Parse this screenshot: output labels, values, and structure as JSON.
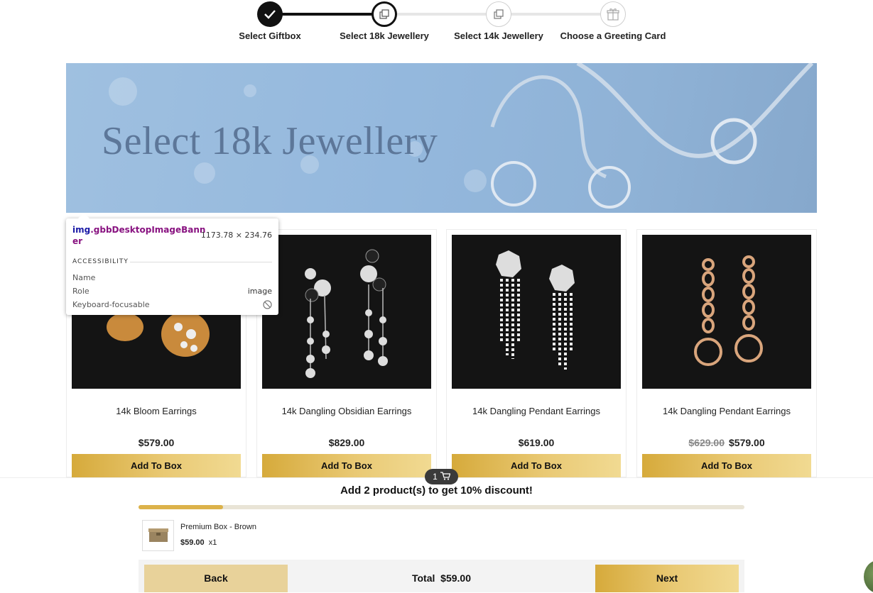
{
  "stepper": {
    "steps": [
      {
        "label": "Select Giftbox",
        "state": "complete"
      },
      {
        "label": "Select 18k Jewellery",
        "state": "current"
      },
      {
        "label": "Select 14k Jewellery",
        "state": "pending"
      },
      {
        "label": "Choose a Greeting Card",
        "state": "pending"
      }
    ]
  },
  "banner": {
    "title": "Select 18k Jewellery"
  },
  "devtools_tooltip": {
    "tag": "img",
    "class_name": ".gbbDesktopImageBann\ner",
    "size": "1173.78 × 234.76",
    "section": "ACCESSIBILITY",
    "name_label": "Name",
    "role_label": "Role",
    "role_value": "image",
    "focusable_label": "Keyboard-focusable"
  },
  "products": [
    {
      "name": "14k Bloom Earrings",
      "price": "$579.00",
      "old_price": "",
      "button": "Add To Box"
    },
    {
      "name": "14k Dangling Obsidian Earrings",
      "price": "$829.00",
      "old_price": "",
      "button": "Add To Box"
    },
    {
      "name": "14k Dangling Pendant Earrings",
      "price": "$619.00",
      "old_price": "",
      "button": "Add To Box"
    },
    {
      "name": "14k Dangling Pendant Earrings",
      "price": "$579.00",
      "old_price": "$629.00",
      "button": "Add To Box"
    }
  ],
  "cart": {
    "count": "1",
    "discount_message": "Add 2 product(s) to get 10% discount!",
    "progress_fraction": 0.14,
    "item": {
      "name": "Premium Box - Brown",
      "price": "$59.00",
      "qty": "x1"
    },
    "back_label": "Back",
    "total_label": "Total",
    "total_value": "$59.00",
    "next_label": "Next"
  },
  "colors": {
    "gold": "#dcb24a",
    "banner_blue": "#94b8dd",
    "dark": "#111111"
  }
}
